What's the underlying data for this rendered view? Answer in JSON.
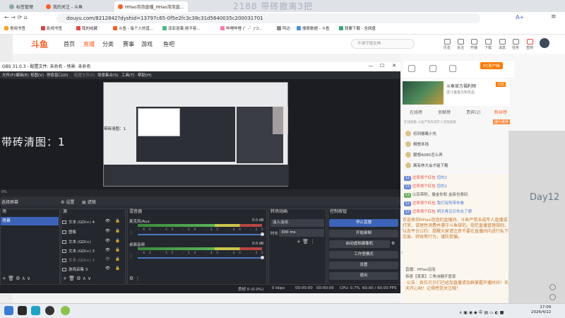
{
  "overlay_title": "2188 带砖撤离3把",
  "browser": {
    "tabs": [
      {
        "label": "标签管理"
      },
      {
        "label": "我的关注 - 斗鱼"
      },
      {
        "label": "HHao泡泡直播_HHao泡泡直…"
      }
    ],
    "url": "douyu.com/8212842?dyshid=13797c65-0f5e2fc3c38c31d5640035c200031701",
    "bookmarks": [
      "常用书签",
      "影视书签",
      "我的收藏",
      "斗鱼 - 每个人的直...",
      "凌亚逆袭:绝不容...",
      "哔哩哔哩 (゜-゜)つ...",
      "阿达",
      "搜索数据 - 斗鱼",
      "我要下载 - 全网盘"
    ]
  },
  "douyu": {
    "logo": "斗鱼",
    "nav": [
      "首页",
      "直播",
      "分类",
      "赛事",
      "游戏",
      "鱼吧"
    ],
    "search_placeholder": "不谓守猿女神",
    "header_icons": [
      "历史",
      "关注",
      "开播",
      "下载",
      "消息",
      "任务",
      "签到"
    ],
    "pc_client": "PC客户端",
    "banner_title": "斗鱼官方福利频",
    "banner_sub": "送斗鱼鱼丸和奖品",
    "banner_btn": "订阅",
    "tabs": [
      "在线榜",
      "贡献榜",
      "贵宾(2)",
      "粉丝榜"
    ],
    "fans_hint": "在线观看 斗鱼严禁未成年人充值直播",
    "fans_btn": "成为贵族",
    "fans": [
      "初到撤离小先",
      "桐想多钱",
      "跟想A080怎么弄",
      "离有林大会才能下载"
    ],
    "chat": [
      {
        "badge": "13",
        "user": "过来领个红包",
        "text": "您的2"
      },
      {
        "badge": "13",
        "user": "过来领个红包",
        "text": "您的2"
      },
      {
        "badge": "13",
        "user": "以后带附，撤金你和",
        "text": "金砖也费码"
      },
      {
        "badge": "13",
        "user": "过来领个红包",
        "text": "我们有阿带你看"
      },
      {
        "badge": "13",
        "user": "过来领个红包",
        "text": "明天再见日你去了哪"
      }
    ],
    "announcement": "欢迎来到HHao泡泡的直播间。斗鱼严禁未成年人直播或打赏，请理性消费并遵守斗鱼规范。规范直播管理规则，以及平台公约：提醒大家请注意不要在直播间内进行私下交易、转账等行为，谨防受骗。",
    "live_label": "直播：",
    "live_user": "HHao泡泡",
    "gift_line": "恭喜【某某】三角洲糖手医家",
    "notice_line": "·公告：各位贝贝们已经加直播请加群掌握开播时间！天天开心呦！记得感觉关注哦！",
    "overlay_day": "Day12"
  },
  "obs": {
    "title": "OBS 31.0.3 - 配置文件: 未命名 - 场景: 未命名",
    "menu": [
      "文件(F)",
      "编辑(E)",
      "视图(V)",
      "停靠窗口(D)",
      "配置文件(P)",
      "场景集合(S)",
      "工具(T)",
      "帮助(H)"
    ],
    "preview_text": "带砖清图：1",
    "inner_preview_text": "带砖清图：1",
    "scene_label": "场景",
    "scenes_header": "选择屏幕",
    "props_btn": "设置",
    "filters_btn": "滤镜",
    "docks": {
      "scenes": "场",
      "sources": "源",
      "mixer": "混音器",
      "transitions": "转场动画",
      "controls": "控制按钮"
    },
    "sources": [
      "文本 (GDI+) 4",
      "图像",
      "文本 (GDI+)",
      "文本 (GDI+) 3",
      "文本 (GDI+) 2",
      "游戏采集 3"
    ],
    "mixer": [
      {
        "name": "麦克风/Aux",
        "db": "0.0 dB"
      },
      {
        "name": "桌面音频",
        "db": "0.0 dB"
      }
    ],
    "mixer_ticks": "-60 -55 -50 -45 -40 -35 -30 -25 -20 -15 -10 -5 0",
    "transition_value": "淡入淡出",
    "duration_label": "时长",
    "duration_value": "300 ms",
    "controls": [
      "停止直播",
      "开始录制",
      "启动虚拟摄像机",
      "工作室模式",
      "设置",
      "退出"
    ],
    "status": {
      "dropped": "丢帧 0 (0.0%)",
      "kbps": "0 kbps",
      "stream_time": "00:00:00",
      "rec_time": "00:00:00",
      "cpu": "CPU: 0.7%",
      "fps": "60.00 / 60.00 FPS"
    }
  },
  "taskbar": {
    "time": "17:09",
    "date": "2026/4/22"
  }
}
